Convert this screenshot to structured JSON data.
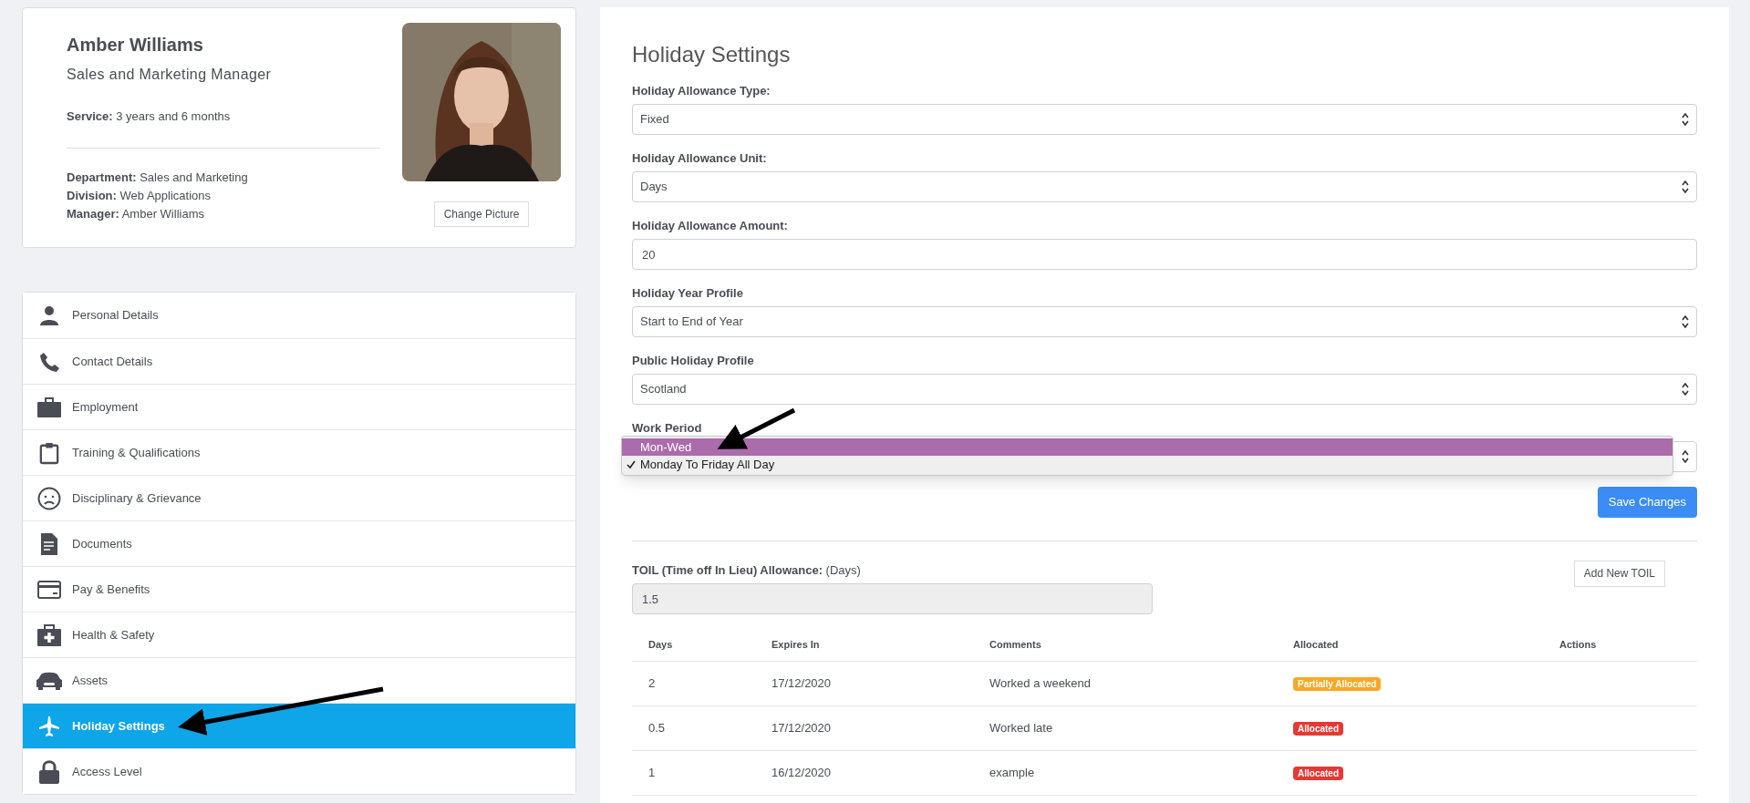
{
  "profile": {
    "name": "Amber Williams",
    "job_title": "Sales and Marketing Manager",
    "service": "**Service:** 3 years and 6 months",
    "details": [
      "**Department:** Sales and Marketing",
      "**Division:** Web Applications",
      "**Manager:** Amber Williams"
    ],
    "change_picture_button": "Change Picture"
  },
  "sidebar": {
    "items": [
      {
        "label": "Personal Details",
        "selected": false
      },
      {
        "label": "Contact Details",
        "selected": false
      },
      {
        "label": "Employment",
        "selected": false
      },
      {
        "label": "Training & Qualifications",
        "selected": false
      },
      {
        "label": "Disciplinary & Grievance",
        "selected": false
      },
      {
        "label": "Documents",
        "selected": false
      },
      {
        "label": "Pay & Benefits",
        "selected": false
      },
      {
        "label": "Health & Safety",
        "selected": false
      },
      {
        "label": "Assets",
        "selected": false
      },
      {
        "label": "Holiday Settings",
        "selected": true
      },
      {
        "label": "Access Level",
        "selected": false
      }
    ]
  },
  "holiday_settings": {
    "title": "Holiday Settings",
    "fields": [
      {
        "label": "Holiday Allowance Type:",
        "kind": "select",
        "value": "Fixed"
      },
      {
        "label": "Holiday Allowance Unit:",
        "kind": "select",
        "value": "Days"
      },
      {
        "label": "Holiday Allowance Amount:",
        "kind": "input",
        "value": "20"
      },
      {
        "label": "Holiday Year Profile",
        "kind": "select",
        "value": "Start to End of Year"
      },
      {
        "label": "Public Holiday Profile",
        "kind": "select",
        "value": "Scotland"
      }
    ],
    "work_period": {
      "label": "Work Period",
      "options": [
        {
          "label": "Mon-Wed",
          "selected": true,
          "checked": false
        },
        {
          "label": "Monday To Friday All Day",
          "selected": false,
          "checked": true
        }
      ]
    },
    "save_button": "Save Changes"
  },
  "toil": {
    "label": "**TOIL (Time off In Lieu) Allowance:** (Days)",
    "value": "1.5",
    "disabled": true,
    "add_button": "Add New TOIL",
    "table": {
      "columns": [
        "Days",
        "Expires In",
        "Comments",
        "Allocated",
        "Actions"
      ],
      "rows": [
        {
          "days": "2",
          "expires_in": "17/12/2020",
          "comments": "Worked a weekend",
          "allocated": {
            "text": "Partially Allocated",
            "color": "#f9a825"
          }
        },
        {
          "days": "0.5",
          "expires_in": "17/12/2020",
          "comments": "Worked late",
          "allocated": {
            "text": "Allocated",
            "color": "#e53935"
          }
        },
        {
          "days": "1",
          "expires_in": "16/12/2020",
          "comments": "example",
          "allocated": {
            "text": "Allocated",
            "color": "#e53935"
          }
        }
      ]
    }
  }
}
